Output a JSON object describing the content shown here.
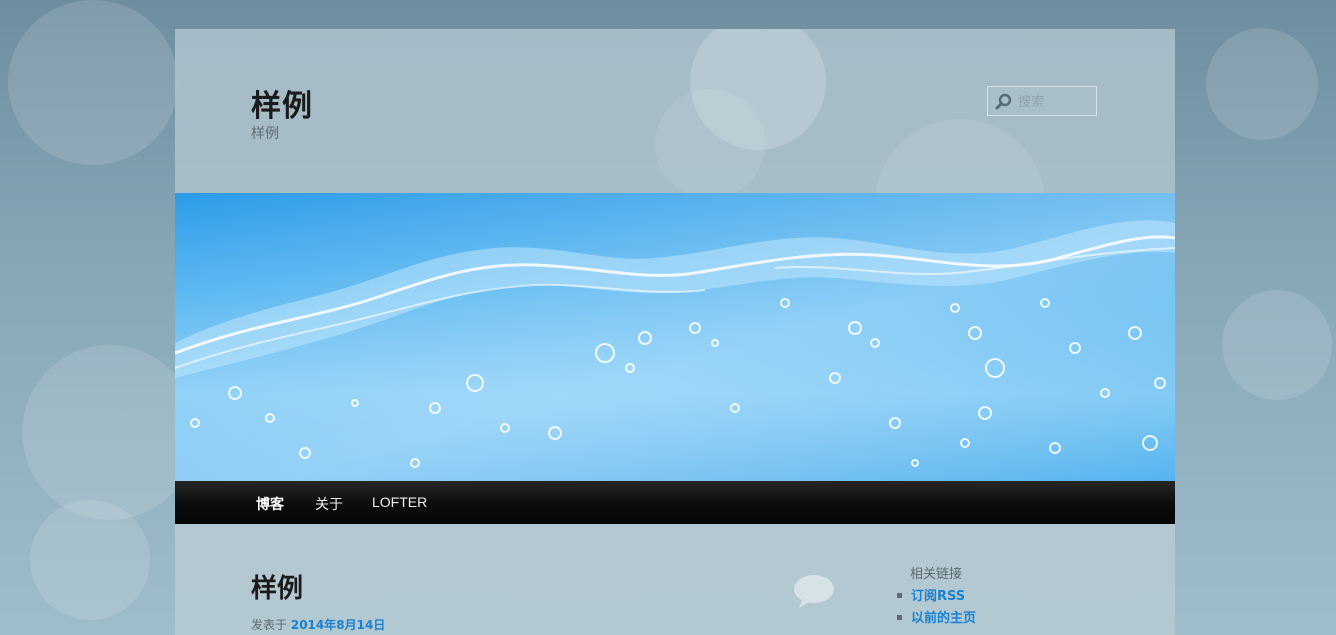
{
  "site": {
    "title": "样例",
    "description": "样例"
  },
  "search": {
    "placeholder": "搜索"
  },
  "nav": {
    "items": [
      {
        "label": "博客",
        "active": true
      },
      {
        "label": "关于",
        "active": false
      },
      {
        "label": "LOFTER",
        "active": false
      }
    ]
  },
  "post": {
    "title": "样例",
    "meta_prefix": "发表于",
    "date": "2014年8月14日"
  },
  "sidebar": {
    "widget_title": "相关链接",
    "links": [
      {
        "label": "订阅RSS"
      },
      {
        "label": "以前的主页"
      }
    ]
  },
  "colors": {
    "link": "#1982d1",
    "nav_bg": "#0c0c0c",
    "banner_water": "#2a9be8"
  },
  "icons": {
    "search": "magnifier-icon",
    "comment": "speech-bubble-icon"
  }
}
